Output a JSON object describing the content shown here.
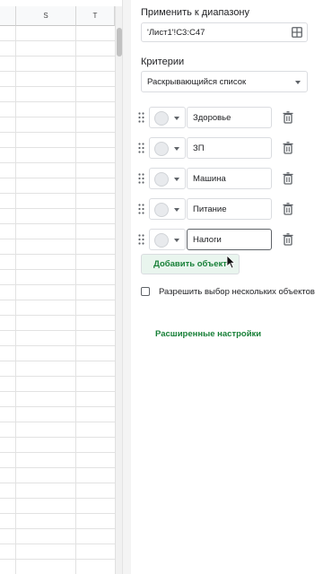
{
  "sheet": {
    "columns": [
      "S",
      "T"
    ]
  },
  "panel": {
    "range_label": "Применить к диапазону",
    "range_value": "'Лист1'!C3:C47",
    "criteria_label": "Критерии",
    "criteria_value": "Раскрывающийся список",
    "items": [
      {
        "value": "Здоровье"
      },
      {
        "value": "ЗП"
      },
      {
        "value": "Машина"
      },
      {
        "value": "Питание"
      },
      {
        "value": "Налоги"
      }
    ],
    "add_item_label": "Добавить объект",
    "multi_select_label": "Разрешить выбор нескольких объектов",
    "advanced_label": "Расширенные настройки"
  },
  "colors": {
    "accent_green": "#188038",
    "button_bg": "#e9f5ee"
  }
}
